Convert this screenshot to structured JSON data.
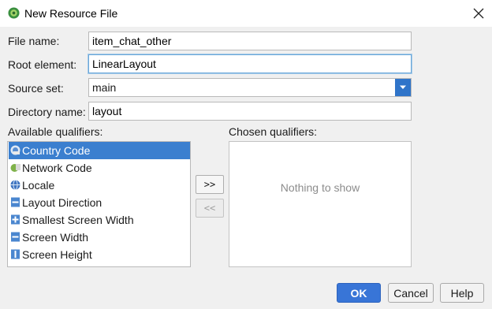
{
  "window": {
    "title": "New Resource File",
    "app_icon": "android-studio-icon",
    "close_icon": "close-icon"
  },
  "form": {
    "file_name_label": "File name:",
    "file_name_value": "item_chat_other",
    "root_element_label": "Root element:",
    "root_element_value": "LinearLayout",
    "source_set_label": "Source set:",
    "source_set_value": "main",
    "directory_name_label": "Directory name:",
    "directory_name_value": "layout"
  },
  "qualifiers": {
    "available_label": "Available qualifiers:",
    "chosen_label": "Chosen qualifiers:",
    "items": [
      {
        "label": "Country Code",
        "icon": "country-code-icon",
        "selected": true
      },
      {
        "label": "Network Code",
        "icon": "network-code-icon",
        "selected": false
      },
      {
        "label": "Locale",
        "icon": "globe-icon",
        "selected": false
      },
      {
        "label": "Layout Direction",
        "icon": "layout-direction-icon",
        "selected": false
      },
      {
        "label": "Smallest Screen Width",
        "icon": "smallest-screen-width-icon",
        "selected": false
      },
      {
        "label": "Screen Width",
        "icon": "screen-width-icon",
        "selected": false
      },
      {
        "label": "Screen Height",
        "icon": "screen-height-icon",
        "selected": false
      }
    ],
    "add_button": ">>",
    "remove_button": "<<",
    "empty_text": "Nothing to show"
  },
  "buttons": {
    "ok": "OK",
    "cancel": "Cancel",
    "help": "Help"
  },
  "colors": {
    "accent": "#3875d7",
    "selection": "#3b7fcf",
    "dropdown_arrow": "#2f74c9",
    "focus_border": "#6aa7d8"
  }
}
